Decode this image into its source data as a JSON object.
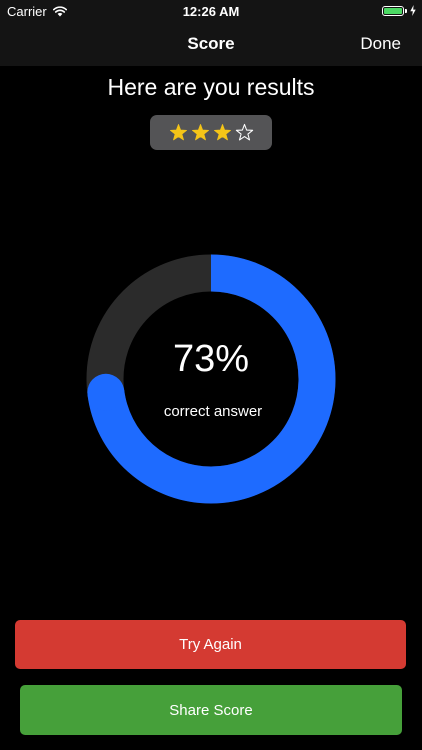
{
  "status_bar": {
    "carrier": "Carrier",
    "time": "12:26 AM",
    "battery_color": "#4cd964"
  },
  "nav": {
    "title": "Score",
    "done_label": "Done"
  },
  "results": {
    "heading": "Here are you results",
    "rating": {
      "filled": 3,
      "total": 4,
      "filled_color": "#f5c518"
    }
  },
  "score": {
    "percent_text": "73%",
    "percent_value": 73,
    "caption": "correct answer",
    "ring_color": "#1e6bff",
    "track_color": "#2b2b2b"
  },
  "buttons": {
    "try_again": {
      "label": "Try Again",
      "color": "#d43a32"
    },
    "share": {
      "label": "Share Score",
      "color": "#46a03a"
    }
  }
}
